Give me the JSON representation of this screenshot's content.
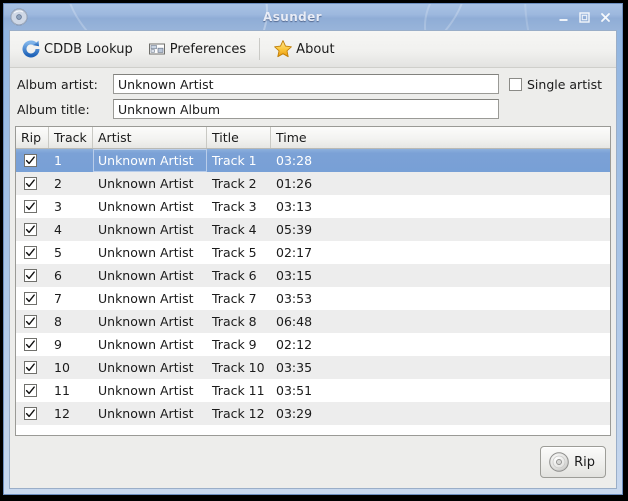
{
  "window": {
    "title": "Asunder",
    "icon": "cd-disc-icon",
    "buttons": [
      {
        "name": "minimize-button",
        "glyph": "minimize"
      },
      {
        "name": "maximize-button",
        "glyph": "maximize"
      },
      {
        "name": "close-button",
        "glyph": "close"
      }
    ]
  },
  "toolbar": {
    "items": [
      {
        "label": "CDDB Lookup",
        "icon": "refresh-icon"
      },
      {
        "label": "Preferences",
        "icon": "preferences-icon"
      },
      {
        "label": "About",
        "icon": "star-icon"
      }
    ]
  },
  "form": {
    "artist_label": "Album artist:",
    "artist_value": "Unknown Artist",
    "title_label": "Album title:",
    "title_value": "Unknown Album",
    "single_artist_label": "Single artist",
    "single_artist_checked": false
  },
  "table": {
    "columns": [
      "Rip",
      "Track",
      "Artist",
      "Title",
      "Time"
    ],
    "rows": [
      {
        "rip": true,
        "track": "1",
        "artist": "Unknown Artist",
        "title": "Track 1",
        "time": "03:28",
        "selected": true
      },
      {
        "rip": true,
        "track": "2",
        "artist": "Unknown Artist",
        "title": "Track 2",
        "time": "01:26",
        "selected": false
      },
      {
        "rip": true,
        "track": "3",
        "artist": "Unknown Artist",
        "title": "Track 3",
        "time": "03:13",
        "selected": false
      },
      {
        "rip": true,
        "track": "4",
        "artist": "Unknown Artist",
        "title": "Track 4",
        "time": "05:39",
        "selected": false
      },
      {
        "rip": true,
        "track": "5",
        "artist": "Unknown Artist",
        "title": "Track 5",
        "time": "02:17",
        "selected": false
      },
      {
        "rip": true,
        "track": "6",
        "artist": "Unknown Artist",
        "title": "Track 6",
        "time": "03:15",
        "selected": false
      },
      {
        "rip": true,
        "track": "7",
        "artist": "Unknown Artist",
        "title": "Track 7",
        "time": "03:53",
        "selected": false
      },
      {
        "rip": true,
        "track": "8",
        "artist": "Unknown Artist",
        "title": "Track 8",
        "time": "06:48",
        "selected": false
      },
      {
        "rip": true,
        "track": "9",
        "artist": "Unknown Artist",
        "title": "Track 9",
        "time": "02:12",
        "selected": false
      },
      {
        "rip": true,
        "track": "10",
        "artist": "Unknown Artist",
        "title": "Track 10",
        "time": "03:35",
        "selected": false
      },
      {
        "rip": true,
        "track": "11",
        "artist": "Unknown Artist",
        "title": "Track 11",
        "time": "03:51",
        "selected": false
      },
      {
        "rip": true,
        "track": "12",
        "artist": "Unknown Artist",
        "title": "Track 12",
        "time": "03:29",
        "selected": false
      }
    ]
  },
  "actions": {
    "rip_label": "Rip",
    "rip_icon": "cd-disc-icon"
  },
  "colors": {
    "selection": "#7ba1d6",
    "titlebar": "#9db8de",
    "row_alt": "#ededed",
    "window_frame": "#a8c4e6"
  }
}
